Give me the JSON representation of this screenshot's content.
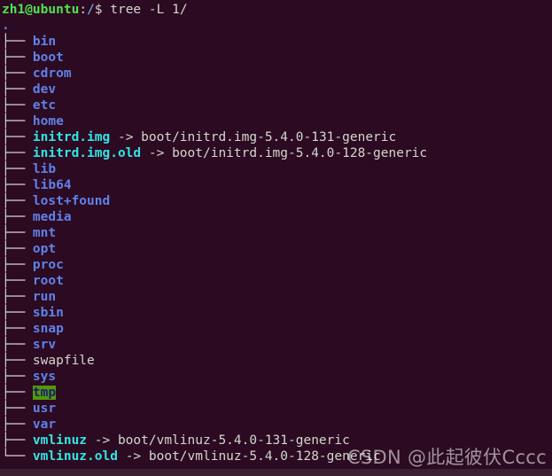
{
  "terminal": {
    "background_color": "#2c0a21",
    "foreground_color": "#d3d7cf",
    "prompt": {
      "user_host": "zh1@ubuntu",
      "separator": ":",
      "cwd": "/",
      "sigil": "$",
      "command": " tree -L 1/"
    },
    "root_label": ".",
    "branch_mid": "├── ",
    "branch_last": "└── ",
    "arrow": " -> ",
    "entries": [
      {
        "name": "bin",
        "type": "dir",
        "target": ""
      },
      {
        "name": "boot",
        "type": "dir",
        "target": ""
      },
      {
        "name": "cdrom",
        "type": "dir",
        "target": ""
      },
      {
        "name": "dev",
        "type": "dir",
        "target": ""
      },
      {
        "name": "etc",
        "type": "dir",
        "target": ""
      },
      {
        "name": "home",
        "type": "dir",
        "target": ""
      },
      {
        "name": "initrd.img",
        "type": "link",
        "target": "boot/initrd.img-5.4.0-131-generic"
      },
      {
        "name": "initrd.img.old",
        "type": "link",
        "target": "boot/initrd.img-5.4.0-128-generic"
      },
      {
        "name": "lib",
        "type": "dir",
        "target": ""
      },
      {
        "name": "lib64",
        "type": "dir",
        "target": ""
      },
      {
        "name": "lost+found",
        "type": "dir",
        "target": ""
      },
      {
        "name": "media",
        "type": "dir",
        "target": ""
      },
      {
        "name": "mnt",
        "type": "dir",
        "target": ""
      },
      {
        "name": "opt",
        "type": "dir",
        "target": ""
      },
      {
        "name": "proc",
        "type": "dir",
        "target": ""
      },
      {
        "name": "root",
        "type": "dir",
        "target": ""
      },
      {
        "name": "run",
        "type": "dir",
        "target": ""
      },
      {
        "name": "sbin",
        "type": "dir",
        "target": ""
      },
      {
        "name": "snap",
        "type": "dir",
        "target": ""
      },
      {
        "name": "srv",
        "type": "dir",
        "target": ""
      },
      {
        "name": "swapfile",
        "type": "file",
        "target": ""
      },
      {
        "name": "sys",
        "type": "dir",
        "target": ""
      },
      {
        "name": "tmp",
        "type": "sticky",
        "target": ""
      },
      {
        "name": "usr",
        "type": "dir",
        "target": ""
      },
      {
        "name": "var",
        "type": "dir",
        "target": ""
      },
      {
        "name": "vmlinuz",
        "type": "link",
        "target": "boot/vmlinuz-5.4.0-131-generic"
      },
      {
        "name": "vmlinuz.old",
        "type": "link",
        "target": "boot/vmlinuz-5.4.0-128-generic"
      }
    ]
  },
  "watermark": {
    "text": "CSDN @此起彼伏Cccc"
  }
}
